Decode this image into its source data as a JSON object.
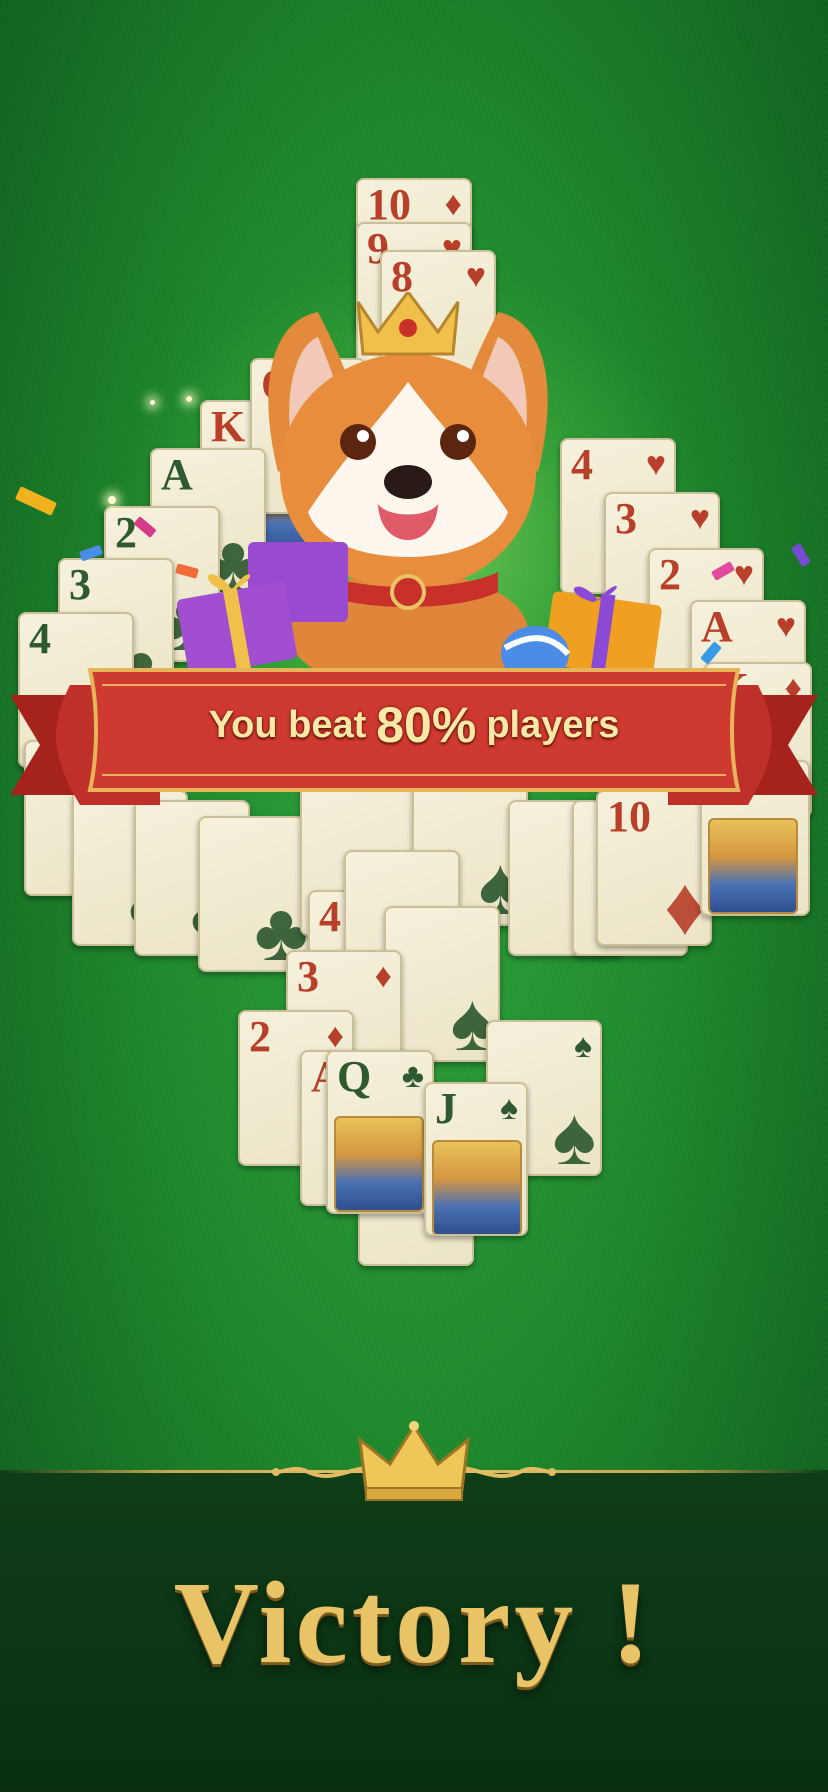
{
  "result": {
    "prefix": "You beat",
    "percent": "80%",
    "suffix": "players",
    "title": "Victory !"
  },
  "cards_top": [
    {
      "rank": "10",
      "suit": "♦",
      "color": "red"
    },
    {
      "rank": "9",
      "suit": "♥",
      "color": "red"
    },
    {
      "rank": "8",
      "suit": "♥",
      "color": "red"
    },
    {
      "rank": "K",
      "suit": "♣",
      "color": "red"
    },
    {
      "rank": "Q",
      "suit": "♣",
      "color": "red"
    },
    {
      "rank": "A",
      "suit": "♣",
      "color": "blk"
    },
    {
      "rank": "2",
      "suit": "♣",
      "color": "blk"
    },
    {
      "rank": "3",
      "suit": "♣",
      "color": "blk"
    },
    {
      "rank": "4",
      "suit": "♣",
      "color": "blk"
    },
    {
      "rank": "4",
      "suit": "♥",
      "color": "red"
    },
    {
      "rank": "3",
      "suit": "♥",
      "color": "red"
    },
    {
      "rank": "2",
      "suit": "♥",
      "color": "red"
    },
    {
      "rank": "A",
      "suit": "♥",
      "color": "red"
    },
    {
      "rank": "K",
      "suit": "♦",
      "color": "red"
    }
  ],
  "cards_bottom": [
    {
      "rank": "10",
      "suit": "♦",
      "color": "red"
    },
    {
      "rank": "4",
      "suit": "♠",
      "color": "red"
    },
    {
      "rank": "3",
      "suit": "♦",
      "color": "red"
    },
    {
      "rank": "2",
      "suit": "♦",
      "color": "red"
    },
    {
      "rank": "A",
      "suit": "♦",
      "color": "red"
    },
    {
      "rank": "Q",
      "suit": "♣",
      "color": "blk"
    },
    {
      "rank": "J",
      "suit": "♠",
      "color": "blk"
    }
  ],
  "colors": {
    "felt": "#1f8a2d",
    "ribbon": "#c8342a",
    "gold": "#e9c466",
    "bottom_band": "#0e3d17"
  },
  "icons": {
    "mascot": "corgi-king-icon",
    "crown": "crown-icon",
    "gift": "gift-box-icon"
  }
}
